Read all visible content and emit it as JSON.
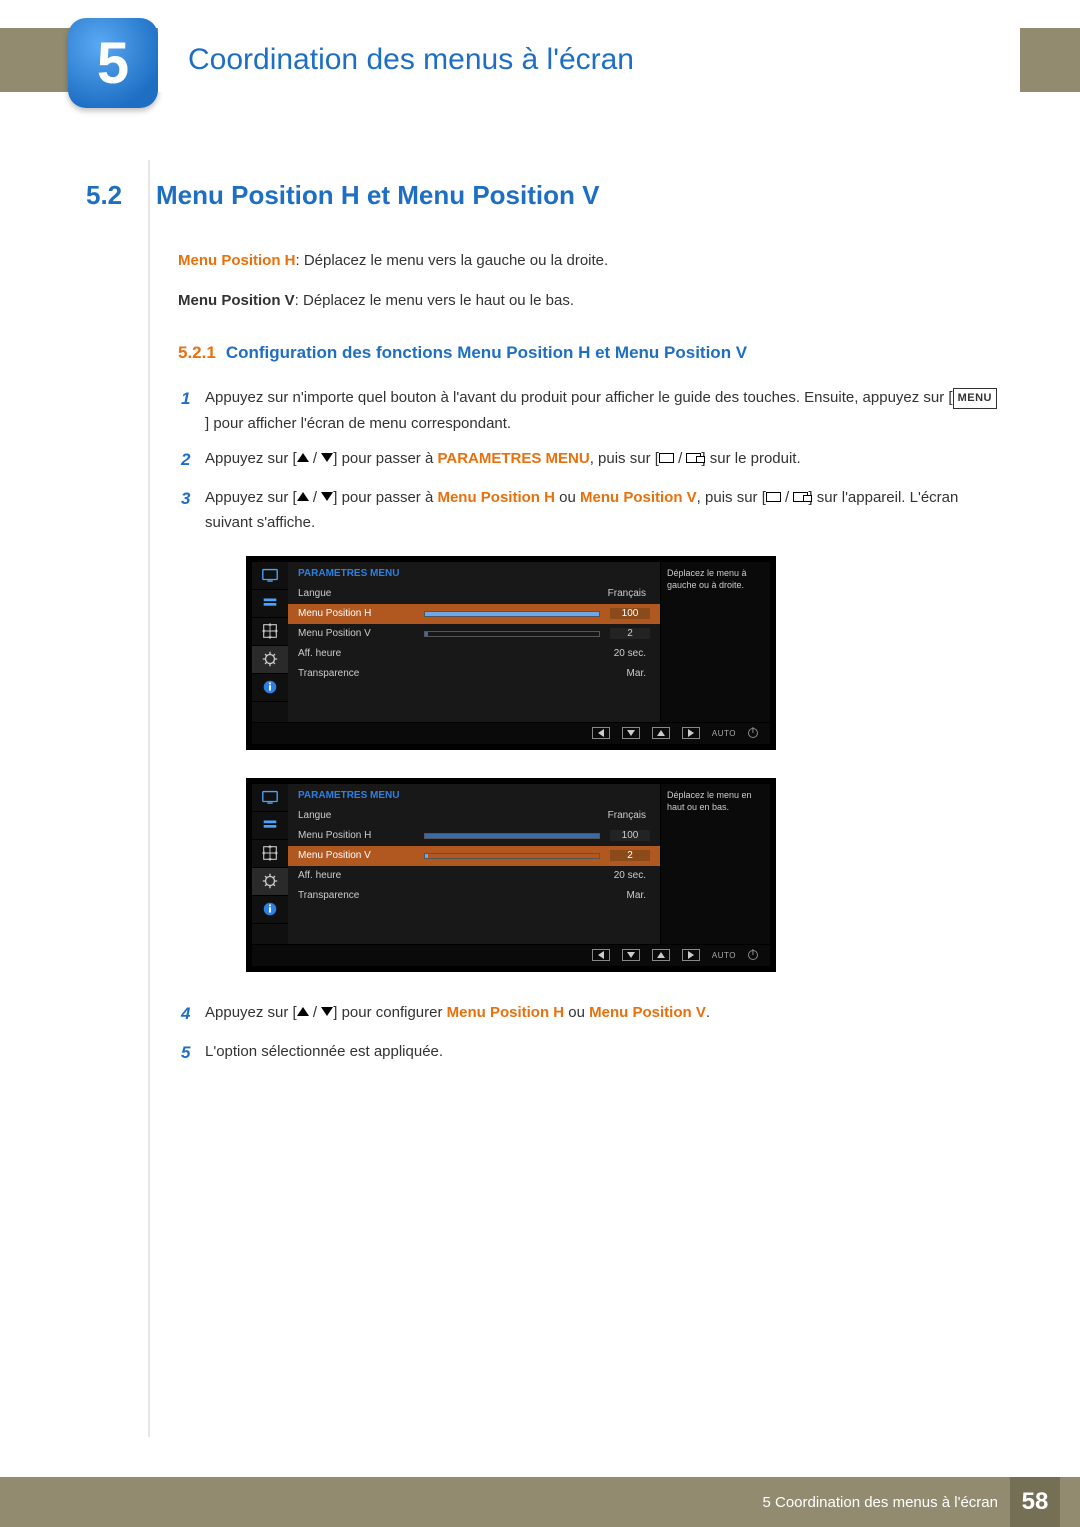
{
  "chapter": {
    "number": "5",
    "title": "Coordination des menus à l'écran"
  },
  "section": {
    "number": "5.2",
    "title": "Menu Position H et Menu Position V"
  },
  "intro": {
    "h_bold": "Menu Position H",
    "h_text": ": Déplacez le menu vers la gauche ou la droite.",
    "v_bold": "Menu Position V",
    "v_text": ": Déplacez le menu vers le haut ou le bas."
  },
  "subsection": {
    "number": "5.2.1",
    "title": "Configuration des fonctions Menu Position H et Menu Position V"
  },
  "steps": {
    "s1a": "Appuyez sur n'importe quel bouton à l'avant du produit pour afficher le guide des touches. Ensuite, appuyez sur [",
    "s1_menu": "MENU",
    "s1b": "] pour afficher l'écran de menu correspondant.",
    "s2a": "Appuyez sur [",
    "s2b": "] pour passer à ",
    "s2_hl": "PARAMETRES MENU",
    "s2c": ", puis sur [",
    "s2d": "] sur le produit.",
    "s3a": "Appuyez sur [",
    "s3b": "] pour passer à ",
    "s3_hl1": "Menu Position H",
    "s3_or": " ou ",
    "s3_hl2": "Menu Position V",
    "s3c": ", puis sur [",
    "s3d": "] sur l'appareil. L'écran suivant s'affiche.",
    "s4a": "Appuyez sur [",
    "s4b": "] pour configurer ",
    "s4_hl1": "Menu Position H",
    "s4_or": " ou ",
    "s4_hl2": "Menu Position V",
    "s4c": ".",
    "s5": "L'option sélectionnée est appliquée."
  },
  "osd": {
    "header": "PARAMETRES MENU",
    "rows": {
      "langue": "Langue",
      "langue_val": "Français",
      "mph": "Menu Position H",
      "mph_val": "100",
      "mpv": "Menu Position V",
      "mpv_val": "2",
      "aff": "Aff. heure",
      "aff_val": "20 sec.",
      "trans": "Transparence",
      "trans_val": "Mar."
    },
    "note1": "Déplacez le menu à gauche ou à droite.",
    "note2": "Déplacez le menu en haut ou en bas.",
    "auto": "AUTO"
  },
  "footer": {
    "text": "5 Coordination des menus à l'écran",
    "page": "58"
  }
}
